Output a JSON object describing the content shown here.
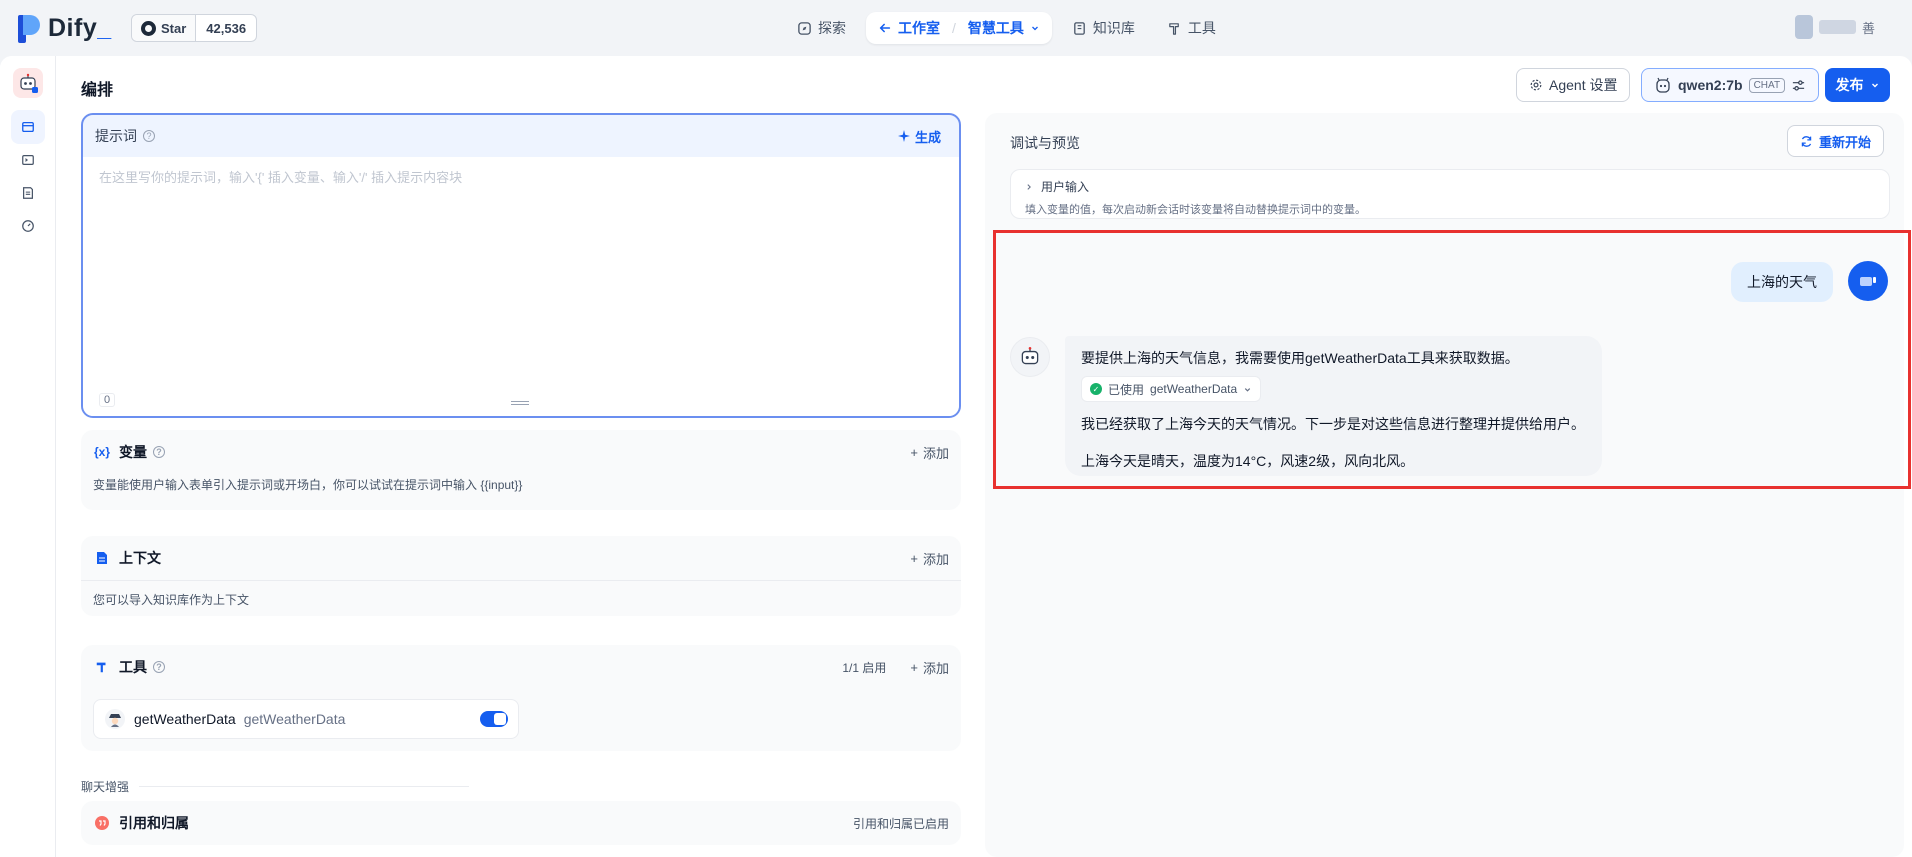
{
  "brand": {
    "name": "Dify",
    "cursor": "_"
  },
  "github": {
    "star_label": "Star",
    "count": "42,536"
  },
  "nav": {
    "explore": "探索",
    "studio": "工作室",
    "app": "智慧工具",
    "knowledge": "知识库",
    "tools": "工具"
  },
  "user": {
    "name_tail": "善"
  },
  "page": {
    "title": "编排"
  },
  "header": {
    "agent_settings": "Agent 设置",
    "model": "qwen2:7b",
    "model_tag": "CHAT",
    "publish": "发布"
  },
  "prompt": {
    "label": "提示词",
    "generate": "生成",
    "placeholder": "在这里写你的提示词，输入'{' 插入变量、输入'/' 插入提示内容块",
    "count": "0"
  },
  "variables": {
    "title": "变量",
    "add": "添加",
    "desc": "变量能使用户输入表单引入提示词或开场白，你可以试试在提示词中输入 {{input}}"
  },
  "context": {
    "title": "上下文",
    "add": "添加",
    "desc": "您可以导入知识库作为上下文"
  },
  "tools_card": {
    "title": "工具",
    "status": "1/1 启用",
    "add": "添加",
    "item_name": "getWeatherData",
    "item_sub": "getWeatherData",
    "enabled": true
  },
  "chat_enhance": {
    "label": "聊天增强",
    "citation_title": "引用和归属",
    "citation_status": "引用和归属已启用"
  },
  "debug": {
    "title": "调试与预览",
    "restart": "重新开始",
    "user_input_label": "用户输入",
    "user_input_desc": "填入变量的值，每次启动新会话时该变量将自动替换提示词中的变量。"
  },
  "chat": {
    "user_message": "上海的天气",
    "bot_intro": "要提供上海的天气信息，我需要使用getWeatherData工具来获取数据。",
    "tool_used_prefix": "已使用",
    "tool_used_name": "getWeatherData",
    "bot_step": "我已经获取了上海今天的天气情况。下一步是对这些信息进行整理并提供给用户。",
    "bot_answer": "上海今天是晴天，温度为14°C，风速2级，风向北风。"
  },
  "colors": {
    "accent": "#155eef",
    "highlight_box": "#e8312f"
  }
}
